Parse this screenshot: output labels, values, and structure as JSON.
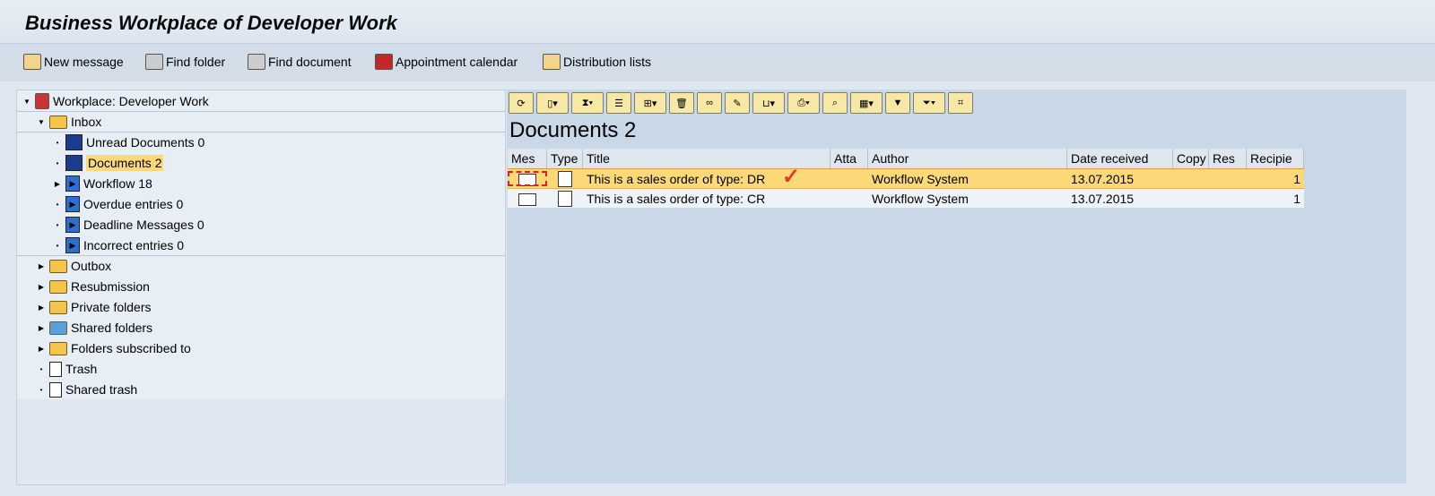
{
  "title": "Business Workplace of Developer Work",
  "appbar": [
    "New message",
    "Find folder",
    "Find document",
    "Appointment calendar",
    "Distribution lists"
  ],
  "tree": {
    "root": "Workplace: Developer Work",
    "inbox": "Inbox",
    "inbox_items": [
      "Unread Documents 0",
      "Documents 2",
      "Workflow 18",
      "Overdue entries 0",
      "Deadline Messages 0",
      "Incorrect entries 0"
    ],
    "folders": [
      "Outbox",
      "Resubmission",
      "Private folders",
      "Shared folders",
      "Folders subscribed to",
      "Trash",
      "Shared trash"
    ]
  },
  "main": {
    "heading": "Documents 2",
    "columns": [
      "Mes",
      "Type",
      "Title",
      "Atta",
      "Author",
      "Date received",
      "Copy",
      "Res",
      "Recipie"
    ],
    "rows": [
      {
        "title": "This is a sales order of type: DR",
        "author": "Workflow System",
        "date": "13.07.2015",
        "recipients": "1"
      },
      {
        "title": "This is a sales order of type: CR",
        "author": "Workflow System",
        "date": "13.07.2015",
        "recipients": "1"
      }
    ]
  },
  "colors": {
    "selected": "#fbd978",
    "check": "#e03a2e"
  }
}
